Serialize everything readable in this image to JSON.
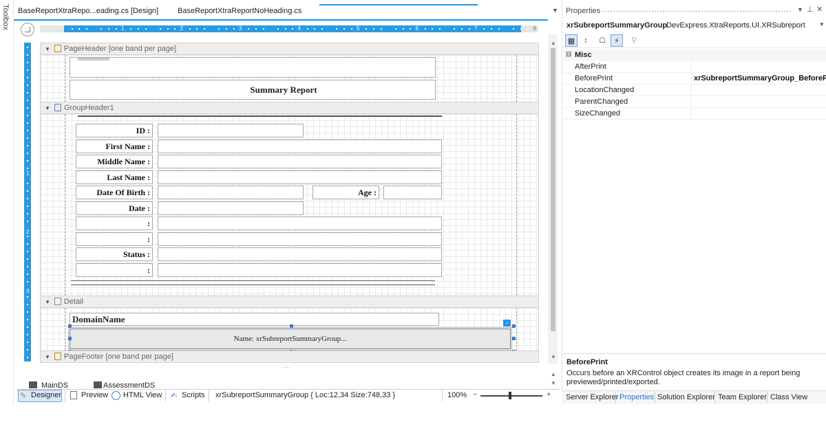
{
  "toolbox": {
    "label": "Toolbox"
  },
  "tabs": [
    {
      "label": "BaseReportXtraRepo...eading.cs [Design]"
    },
    {
      "label": "BaseReportXtraReportNoHeading.cs"
    },
    {
      "label": ""
    }
  ],
  "ruler": {
    "h_numbers": [
      "1",
      "2",
      "3",
      "4",
      "5",
      "6",
      "7",
      "8"
    ],
    "v_numbers": [
      "1",
      "2",
      "3"
    ]
  },
  "bands": {
    "page_header": "PageHeader [one band per page]",
    "group_header": "GroupHeader1",
    "detail": "Detail",
    "page_footer": "PageFooter [one band per page]"
  },
  "report": {
    "title": "Summary Report",
    "labels": {
      "id": "ID :",
      "first_name": "First Name :",
      "middle_name": "Middle Name :",
      "last_name": "Last Name :",
      "date_of_birth": "Date Of Birth :",
      "age": "Age :",
      "date": "Date :",
      "blank1": ":",
      "blank2": ":",
      "status": "Status :",
      "blank3": ":"
    },
    "domain_name": "DomainName",
    "subreport_text": "Name: xrSubreportSummaryGroup..."
  },
  "bottom_tabs": [
    "MainDS",
    "AssessmentDS"
  ],
  "statusbar": {
    "designer": "Designer",
    "preview": "Preview",
    "html_view": "HTML View",
    "scripts": "Scripts",
    "selection_info": "xrSubreportSummaryGroup { Loc:12,34 Size:748,33 }",
    "zoom": "100%",
    "zoom_level": 0.7
  },
  "properties": {
    "title": "Properties",
    "object_name": "xrSubreportSummaryGroup",
    "object_type": "DevExpress.XtraReports.UI.XRSubreport",
    "category": "Misc",
    "rows": [
      {
        "name": "AfterPrint",
        "value": ""
      },
      {
        "name": "BeforePrint",
        "value": "xrSubreportSummaryGroup_BeforePrint"
      },
      {
        "name": "LocationChanged",
        "value": ""
      },
      {
        "name": "ParentChanged",
        "value": ""
      },
      {
        "name": "SizeChanged",
        "value": ""
      }
    ],
    "description_title": "BeforePrint",
    "description_text": "Occurs before an XRControl object creates its image in a report being previewed/printed/exported.",
    "bottom_tabs": [
      "Server Explorer",
      "Properties",
      "Solution Explorer",
      "Team Explorer",
      "Class View"
    ],
    "active_tab_color": "#1c73d8"
  }
}
